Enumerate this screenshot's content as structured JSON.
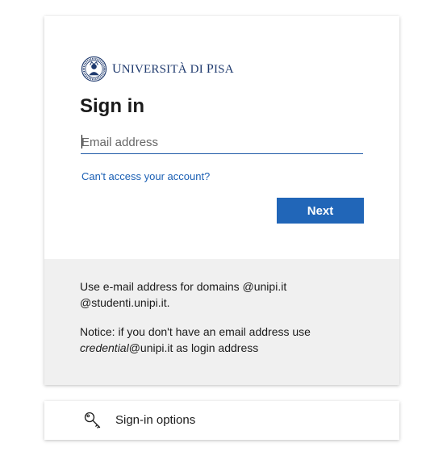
{
  "brand": {
    "name_prefix": "U",
    "name_main": "NIVERSITÀ DI ",
    "name_suffix_cap": "P",
    "name_suffix": "ISA",
    "logo_icon": "university-seal-icon",
    "color": "#1f3a6e"
  },
  "signin": {
    "title": "Sign in",
    "email_placeholder": "Email address",
    "email_value": "",
    "cant_access_link": "Can't access your account?",
    "next_button": "Next",
    "accent_color": "#2166b8"
  },
  "notice": {
    "line1": "Use e-mail address for domains @unipi.it @studenti.unipi.it.",
    "line2_prefix": "Notice: if you don't have an email address use ",
    "line2_italic": "credential",
    "line2_suffix": "@unipi.it as login address"
  },
  "options": {
    "label": "Sign-in options",
    "icon": "key-icon"
  }
}
